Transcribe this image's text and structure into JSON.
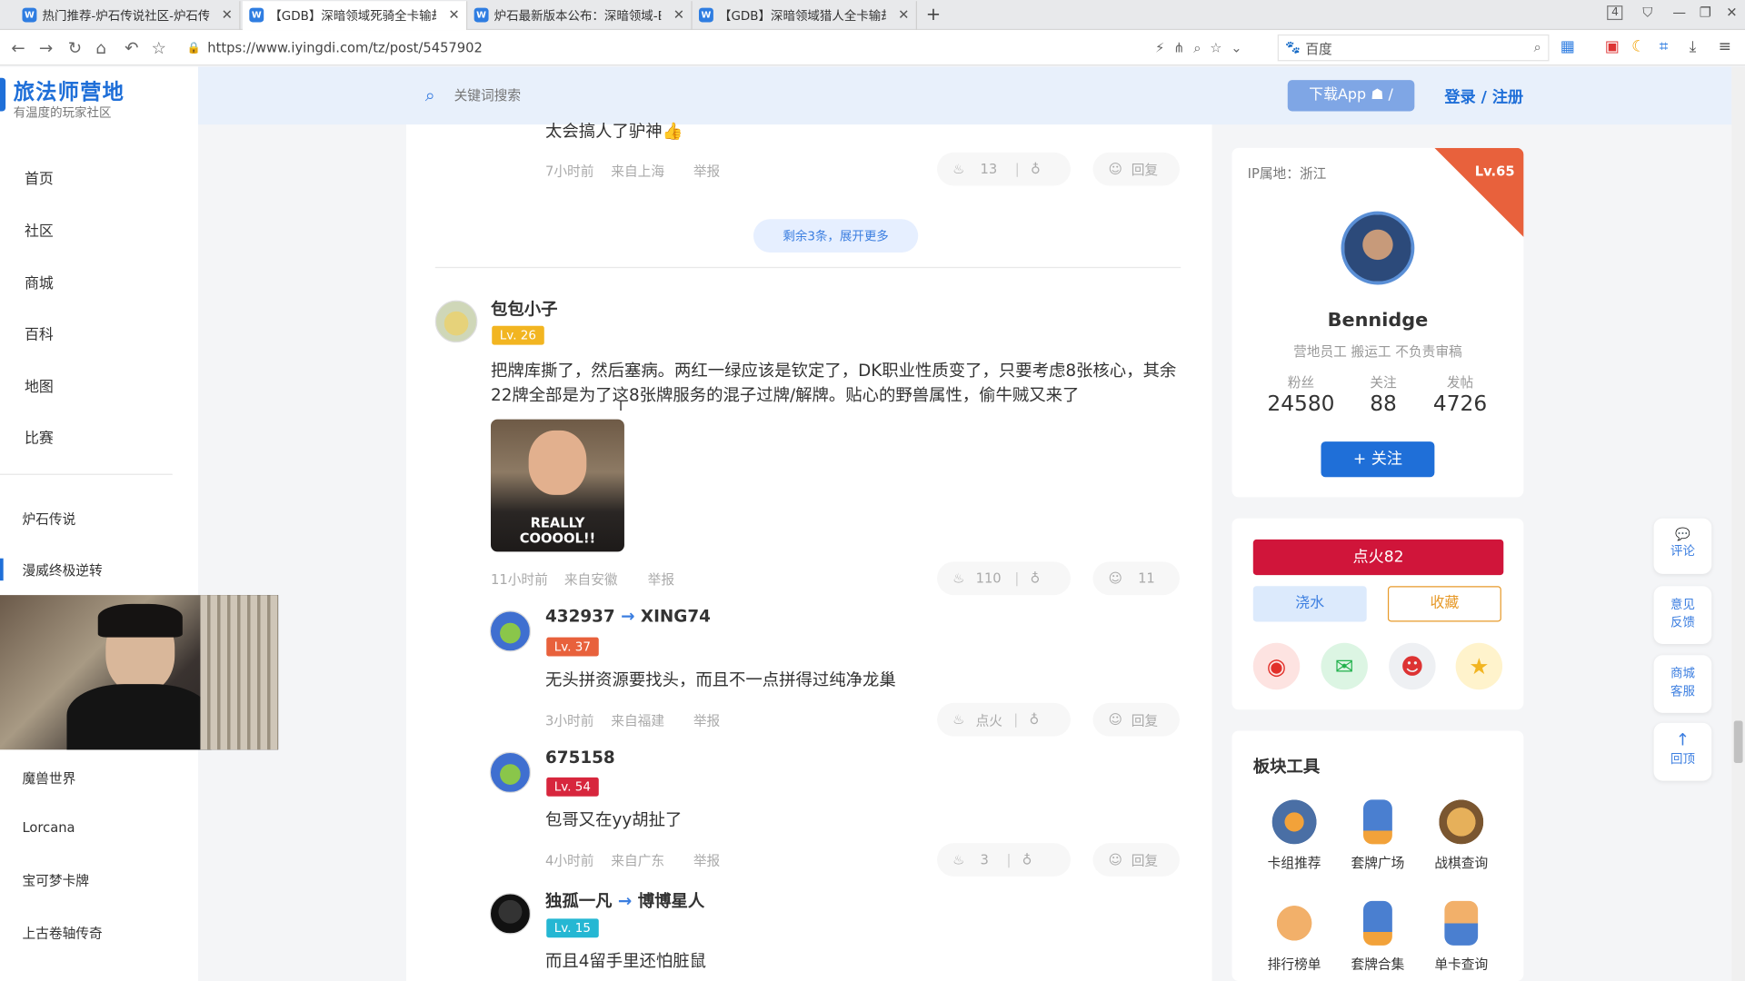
{
  "browser": {
    "tabs": [
      {
        "label": "热门推荐-炉石传说社区-炉石传"
      },
      {
        "label": "【GDB】深暗领域死骑全卡输劫"
      },
      {
        "label": "炉石最新版本公布：深暗领域-Be"
      },
      {
        "label": "【GDB】深暗领域猎人全卡输劫"
      }
    ],
    "tab_count": "4",
    "url": "https://www.iyingdi.com/tz/post/5457902",
    "search_engine": "百度"
  },
  "site": {
    "logo_title": "旅法师营地",
    "logo_subtitle": "有温度的玩家社区",
    "search_placeholder": "关键词搜索",
    "download_label": "下载App",
    "login_label": "登录 / 注册"
  },
  "nav": {
    "items": [
      "首页",
      "社区",
      "商城",
      "百科",
      "地图",
      "比赛"
    ],
    "games": [
      "炉石传说",
      "漫威终极逆转",
      "魔兽世界",
      "Lorcana",
      "宝可梦卡牌",
      "上古卷轴传奇"
    ]
  },
  "comments": {
    "prev_reply": {
      "text": "太会搞人了驴神👍",
      "time": "7小时前",
      "location": "来自上海",
      "report": "举报",
      "likes": "13",
      "reply": "回复"
    },
    "expand_more": "剩余3条，展开更多",
    "main": {
      "username": "包包小子",
      "level": "Lv. 26",
      "text_line1": "把牌库撕了，然后塞病。两红一绿应该是钦定了，DK职业性质变了，只要考虑8张核心，其余",
      "text_line2": "22牌全部是为了这8张牌服务的混子过牌/解牌。贴心的野兽属性，偷牛贼又来了",
      "image_caption": "REALLY COOOOL!!",
      "time": "11小时前",
      "location": "来自安徽",
      "report": "举报",
      "likes": "110",
      "replies_count": "11"
    },
    "replies": [
      {
        "username": "432937",
        "arrow": "→",
        "target": "XING74",
        "level": "Lv. 37",
        "level_color": "#e8613c",
        "text": "无头拼资源要找头，而且不一点拼得过纯净龙巢",
        "time": "3小时前",
        "location": "来自福建",
        "report": "举报",
        "likes": "点火",
        "reply": "回复"
      },
      {
        "username": "675158",
        "arrow": "",
        "target": "",
        "level": "Lv. 54",
        "level_color": "#d7263d",
        "text": "包哥又在yy胡扯了",
        "time": "4小时前",
        "location": "来自广东",
        "report": "举报",
        "likes": "3",
        "reply": "回复"
      },
      {
        "username": "独孤一凡",
        "arrow": "→",
        "target": "博博星人",
        "level": "Lv. 15",
        "level_color": "#25b7d3",
        "text": "而且4留手里还怕脏鼠",
        "time": "",
        "location": "",
        "report": "",
        "likes": "",
        "reply": ""
      }
    ]
  },
  "author": {
    "ip": "IP属地：浙江",
    "level": "Lv.65",
    "name": "Bennidge",
    "desc": "营地员工 搬运工 不负责审稿",
    "stats": [
      {
        "label": "粉丝",
        "value": "24580"
      },
      {
        "label": "关注",
        "value": "88"
      },
      {
        "label": "发帖",
        "value": "4726"
      }
    ],
    "follow_label": "+ 关注"
  },
  "actions": {
    "fire_label": "点火82",
    "water_label": "浇水",
    "collect_label": "收藏"
  },
  "tools": {
    "title": "板块工具",
    "items": [
      "卡组推荐",
      "套牌广场",
      "战棋查询",
      "排行榜单",
      "套牌合集",
      "单卡查询"
    ]
  },
  "floating": {
    "comment": "评论",
    "feedback_1": "意见",
    "feedback_2": "反馈",
    "service_1": "商城",
    "service_2": "客服",
    "top": "回顶"
  },
  "colors": {
    "brand_blue": "#1f6fd8",
    "fire_red": "#d0153a",
    "level_gold": "#f2b521"
  }
}
